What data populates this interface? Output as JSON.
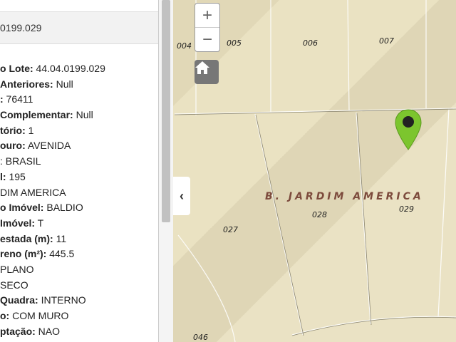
{
  "panel": {
    "title": "0199.029",
    "fields": [
      {
        "label": "o Lote:",
        "value": " 44.04.0199.029"
      },
      {
        "label": "Anteriores:",
        "value": " Null"
      },
      {
        "label": ":",
        "value": " 76411"
      },
      {
        "label": " Complementar:",
        "value": " Null"
      },
      {
        "label": "tório:",
        "value": " 1"
      },
      {
        "label": "ouro:",
        "value": " AVENIDA"
      },
      {
        "label": "",
        "value": ": BRASIL"
      },
      {
        "label": "l:",
        "value": " 195"
      },
      {
        "label": "",
        "value": "DIM AMERICA"
      },
      {
        "label": "o Imóvel:",
        "value": " BALDIO"
      },
      {
        "label": " Imóvel:",
        "value": " T"
      },
      {
        "label": "estada (m):",
        "value": " 11"
      },
      {
        "label": "reno (m²):",
        "value": " 445.5"
      },
      {
        "label": "",
        "value": "PLANO"
      },
      {
        "label": "",
        "value": "SECO"
      },
      {
        "label": " Quadra:",
        "value": " INTERNO"
      },
      {
        "label": "o:",
        "value": " COM MURO"
      },
      {
        "label": "ptação:",
        "value": " NAO"
      }
    ]
  },
  "map": {
    "zoom_in": "+",
    "zoom_out": "−",
    "collapse": "‹",
    "neighborhood": "B. JARDIM AMERICA",
    "lots": [
      "004",
      "005",
      "006",
      "007",
      "027",
      "028",
      "029",
      "046"
    ],
    "pin_color": "#7cc52e",
    "icons": {
      "home": "home-icon",
      "pin": "map-pin-icon"
    }
  }
}
